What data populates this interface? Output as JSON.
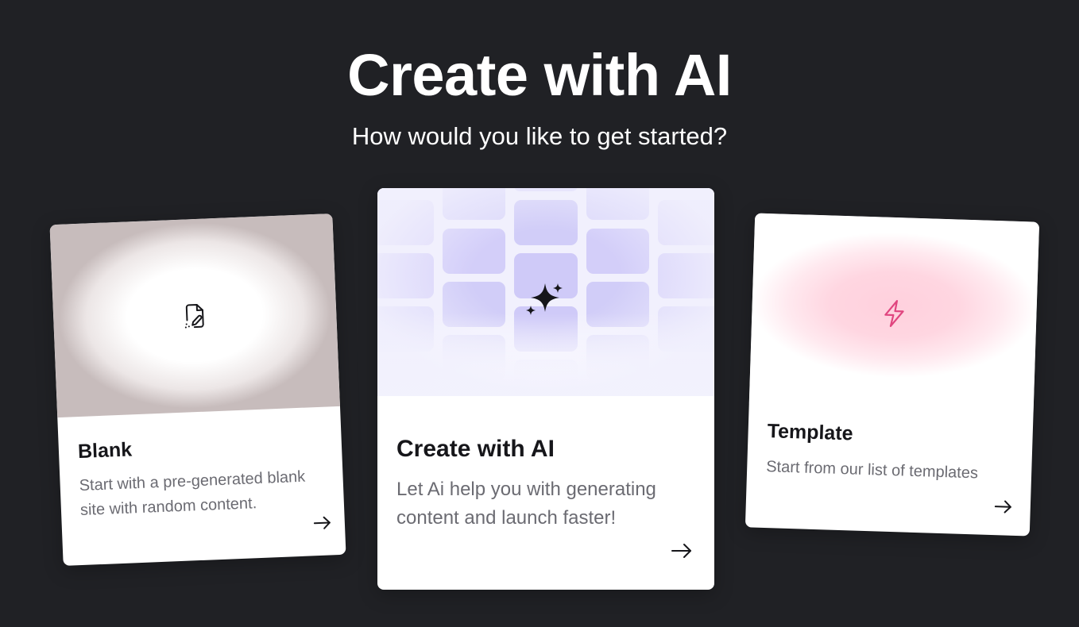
{
  "header": {
    "title": "Create with AI",
    "subtitle": "How would you like to get started?"
  },
  "cards": {
    "blank": {
      "title": "Blank",
      "description": "Start with a pre-generated blank site with random content.",
      "icon": "file-edit-icon",
      "arrow_icon": "arrow-right-icon"
    },
    "ai": {
      "title": "Create with AI",
      "description": "Let Ai help you with generating content and launch faster!",
      "icon": "sparkles-icon",
      "arrow_icon": "arrow-right-icon",
      "accent_color": "#cfcaf8"
    },
    "template": {
      "title": "Template",
      "description": "Start from our list of templates",
      "icon": "lightning-icon",
      "arrow_icon": "arrow-right-icon",
      "accent_color": "#e0457f"
    }
  },
  "colors": {
    "background": "#202125",
    "card_background": "#ffffff",
    "title_text": "#16161a",
    "description_text": "#6b6b72"
  }
}
